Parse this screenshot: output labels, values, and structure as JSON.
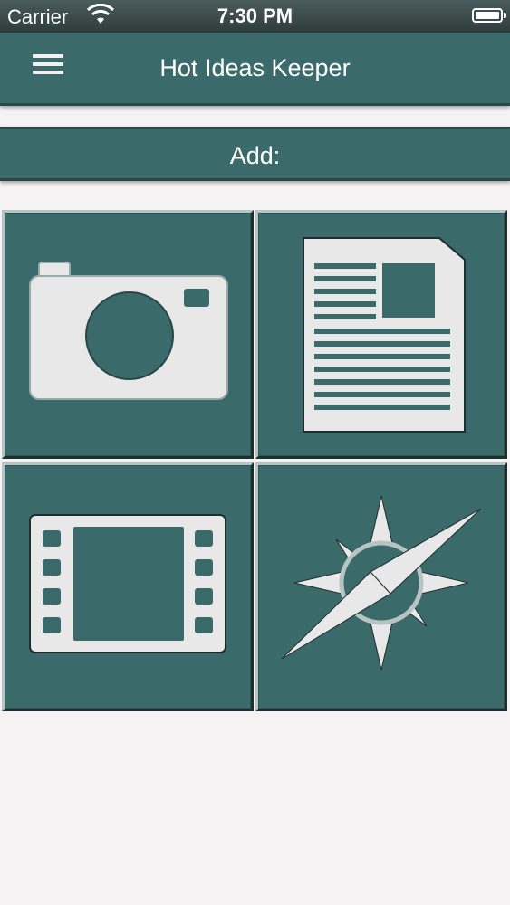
{
  "status_bar": {
    "carrier": "Carrier",
    "time": "7:30 PM"
  },
  "navbar": {
    "title": "Hot Ideas Keeper",
    "menu_icon": "hamburger-menu-icon"
  },
  "add_section": {
    "label": "Add:"
  },
  "tiles": [
    {
      "name": "camera",
      "icon": "camera-icon"
    },
    {
      "name": "note",
      "icon": "document-icon"
    },
    {
      "name": "video",
      "icon": "film-icon"
    },
    {
      "name": "link",
      "icon": "compass-icon"
    }
  ],
  "colors": {
    "accent": "#3a6a6a",
    "icon": "#e8e8e8",
    "background": "#f4f2f2"
  }
}
